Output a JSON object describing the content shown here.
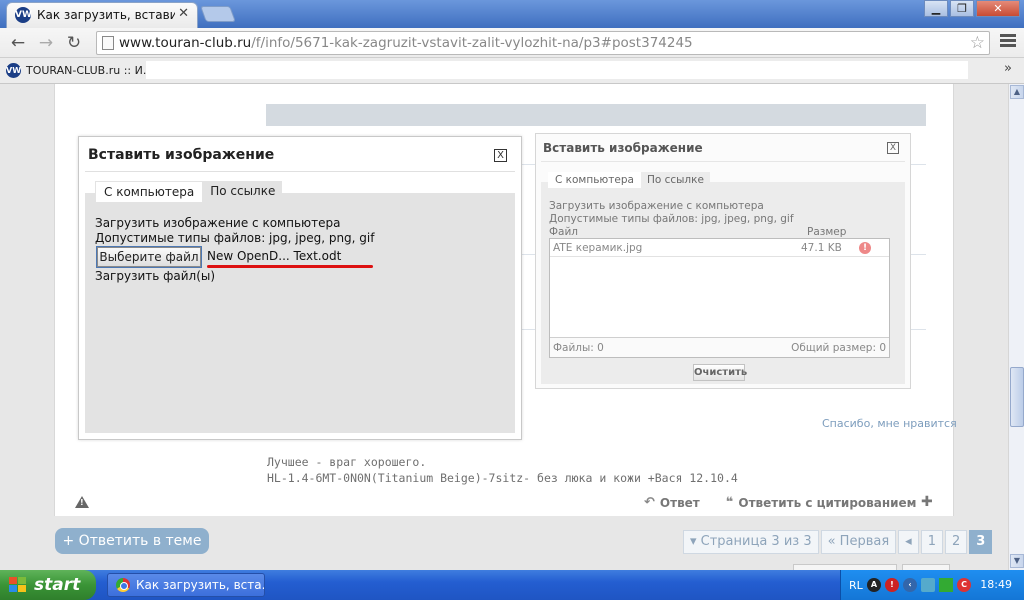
{
  "browser": {
    "tab_title": "Как загрузить, вставить ,",
    "tab_favicon": "VW",
    "url_host": "www.touran-club.ru",
    "url_path": "/f/info/5671-kak-zagruzit-vstavit-zalit-vylozhit-na/p3#post374245",
    "bookmark_label": "TOURAN-CLUB.ru :: И...",
    "bookmarks_more": "»",
    "window_buttons": {
      "minimize": "▁",
      "maximize": "❐",
      "close": "✕"
    },
    "nav_icons": {
      "back": "←",
      "forward": "→",
      "reload": "↻",
      "star": "☆"
    }
  },
  "dialog_main": {
    "title": "Вставить изображение",
    "close_label": "X",
    "tabs": [
      "С компьютера",
      "По ссылке"
    ],
    "line1": "Загрузить изображение с компьютера",
    "line2": "Допустимые типы файлов: jpg, jpeg, png, gif",
    "choose_button": "Выберите файл",
    "chosen_file": "New OpenD... Text.odt",
    "upload_link": "Загрузить файл(ы)",
    "annotation_color": "#dd1111"
  },
  "dialog_bg": {
    "title": "Вставить изображение",
    "close_label": "X",
    "tabs": [
      "С компьютера",
      "По ссылке"
    ],
    "line1": "Загрузить изображение с компьютера",
    "line2": "Допустимые типы файлов: jpg, jpeg, png, gif",
    "col_file": "Файл",
    "col_size": "Размер",
    "file_name": "ATE керамик.jpg",
    "file_size": "47.1 KB",
    "file_error_icon": "!",
    "files_count": "Файлы: 0",
    "total_size": "Общий размер: 0",
    "clear_button": "Очистить"
  },
  "post": {
    "thanks_link": "Спасибо, мне нравится",
    "signature_line1": "Лучшее - враг хорошего.",
    "signature_line2": "HL-1.4-6MT-0N0N(Titanium Beige)-7sitz- без люка и кожи +Вася 12.10.4",
    "reply_action": "Ответ",
    "quote_action": "Ответить с цитированием",
    "reply_icon": "↶",
    "quote_icon": "❝"
  },
  "thread": {
    "reply_in_thread": "+ Ответить в теме",
    "pager": {
      "status": "▾ Страница 3 из 3",
      "first": "« Первая",
      "prev": "◂",
      "pages": [
        "1",
        "2",
        "3"
      ],
      "current": "3"
    }
  },
  "taskbar": {
    "start_label": "start",
    "task_item": "Как загрузить, вста...",
    "lang": "RL",
    "time": "18:49"
  }
}
